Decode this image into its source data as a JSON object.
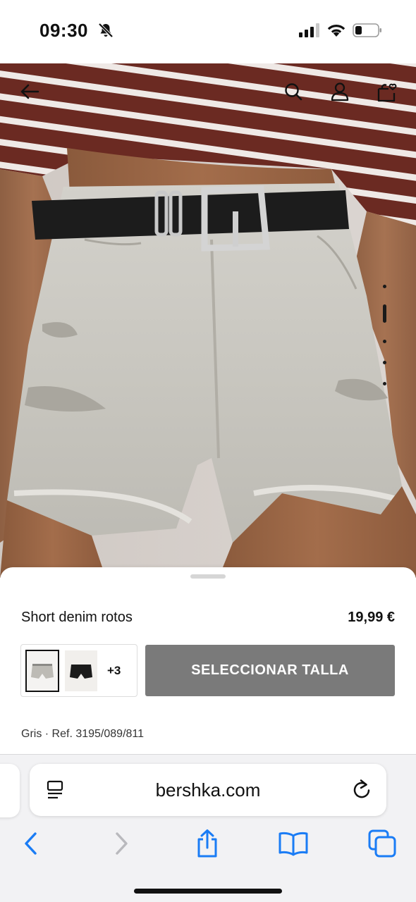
{
  "status_bar": {
    "time": "09:30",
    "icons": [
      "bell-slash-icon",
      "cellular-signal-icon",
      "wifi-icon",
      "battery-icon"
    ]
  },
  "image_toolbar": {
    "icons": [
      "arrow-left-icon",
      "search-icon",
      "user-icon",
      "shopping-bag-icon"
    ]
  },
  "gallery": {
    "total_images": 6,
    "active_index": 1
  },
  "product": {
    "name": "Short denim rotos",
    "price": "19,99 €",
    "more_colors": "+3",
    "select_size_label": "SELECCIONAR TALLA",
    "reference": "Gris · Ref. 3195/089/811",
    "swatches": [
      "swatch-grey-denim",
      "swatch-black-denim"
    ]
  },
  "browser": {
    "url": "bershka.com",
    "icons": [
      "reader-icon",
      "reload-icon",
      "chevron-left-icon",
      "chevron-right-icon",
      "share-icon",
      "bookmarks-icon",
      "tabs-icon"
    ]
  },
  "colors": {
    "accent_blue": "#1a7cf5",
    "button_grey": "#7a7a7a",
    "stripe_brown": "#6b2a22"
  }
}
